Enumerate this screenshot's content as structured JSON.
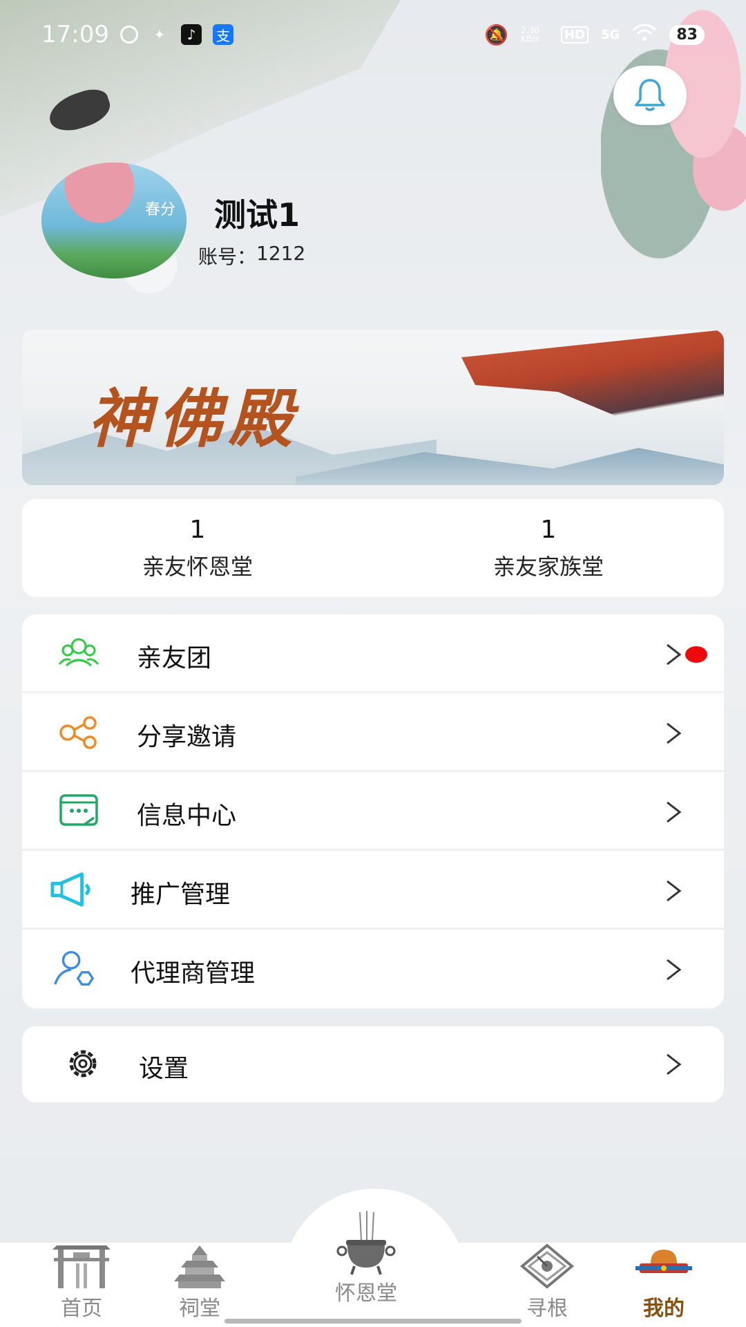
{
  "status_bar": {
    "time": "17:09",
    "app_icons": [
      "message-icon",
      "game-icon",
      "tiktok-icon",
      "alipay-icon"
    ],
    "alipay_glyph": "支",
    "net_speed": "2.30 KB/s",
    "hd_label": "HD",
    "network": "5G",
    "battery": "83"
  },
  "profile": {
    "name": "测试1",
    "account_label": "账号：",
    "account_value": "1212",
    "avatar_text": "春分"
  },
  "banner": {
    "title": "神佛殿"
  },
  "stats": [
    {
      "value": "1",
      "label": "亲友怀恩堂"
    },
    {
      "value": "1",
      "label": "亲友家族堂"
    }
  ],
  "menu": [
    {
      "label": "亲友团",
      "icon": "group-icon",
      "has_badge": true,
      "color": "#2ecc40"
    },
    {
      "label": "分享邀请",
      "icon": "share-icon",
      "has_badge": false,
      "color": "#f08a24"
    },
    {
      "label": "信息中心",
      "icon": "message-center-icon",
      "has_badge": false,
      "color": "#1fa866"
    },
    {
      "label": "推广管理",
      "icon": "megaphone-icon",
      "has_badge": false,
      "color": "#1ec2e0"
    },
    {
      "label": "代理商管理",
      "icon": "agent-icon",
      "has_badge": false,
      "color": "#3a8fe0"
    }
  ],
  "settings": {
    "label": "设置",
    "icon": "gear-icon"
  },
  "tabbar": [
    {
      "label": "首页",
      "icon": "archway-icon",
      "active": false
    },
    {
      "label": "祠堂",
      "icon": "temple-icon",
      "active": false
    },
    {
      "label": "怀恩堂",
      "icon": "incense-burner-icon",
      "active": false
    },
    {
      "label": "寻根",
      "icon": "compass-icon",
      "active": false
    },
    {
      "label": "我的",
      "icon": "official-hat-icon",
      "active": true
    }
  ],
  "colors": {
    "accent_active": "#8a4f0f",
    "badge_red": "#ee0a0a",
    "banner_title": "#b5531f"
  }
}
